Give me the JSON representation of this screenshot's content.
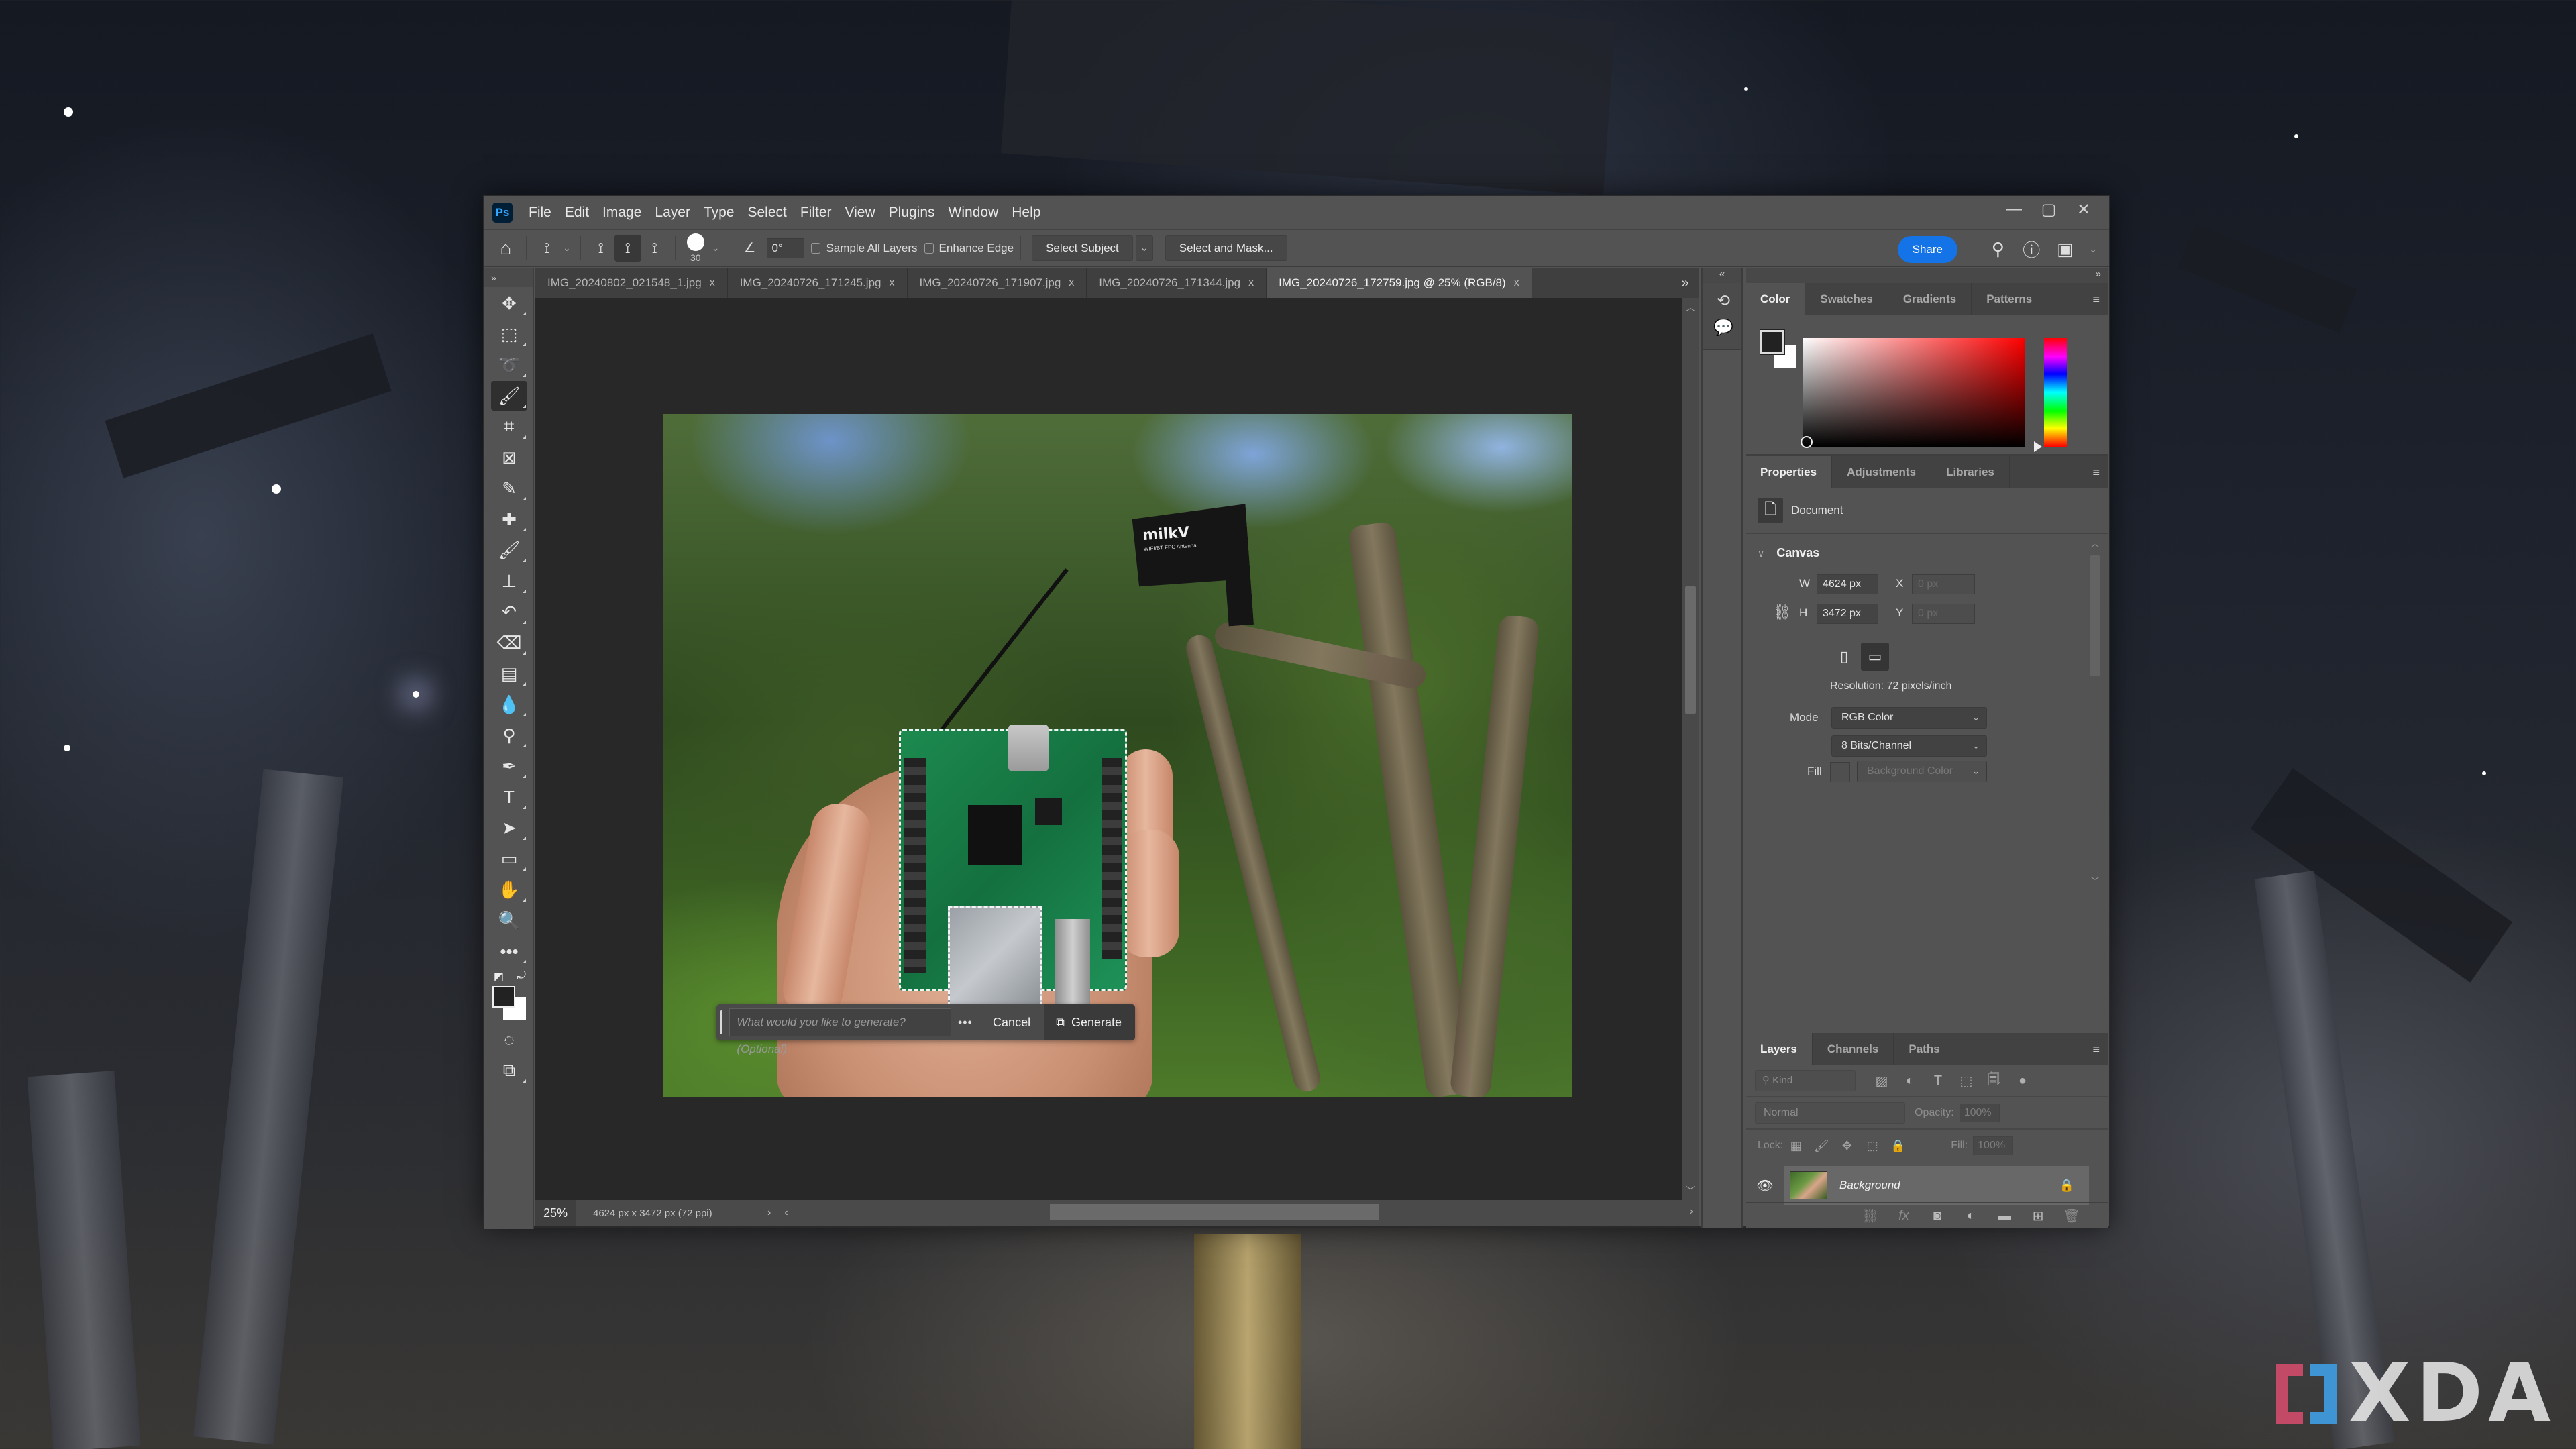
{
  "app": {
    "name": "Photoshop",
    "logo_text": "Ps",
    "menu": [
      "File",
      "Edit",
      "Image",
      "Layer",
      "Type",
      "Select",
      "Filter",
      "View",
      "Plugins",
      "Window",
      "Help"
    ],
    "window_controls": {
      "minimize": "—",
      "maximize": "▢",
      "close": "✕"
    }
  },
  "options_bar": {
    "brush_size": "30",
    "angle": "0°",
    "sample_all_layers": {
      "label": "Sample All Layers",
      "checked": false
    },
    "enhance_edge": {
      "label": "Enhance Edge",
      "checked": false
    },
    "select_subject": "Select Subject",
    "select_and_mask": "Select and Mask...",
    "share": "Share",
    "accent_color": "#1473e6"
  },
  "tabs": [
    {
      "label": "IMG_20240802_021548_1.jpg",
      "active": false
    },
    {
      "label": "IMG_20240726_171245.jpg",
      "active": false
    },
    {
      "label": "IMG_20240726_171907.jpg",
      "active": false
    },
    {
      "label": "IMG_20240726_171344.jpg",
      "active": false
    },
    {
      "label": "IMG_20240726_172759.jpg @ 25% (RGB/8)",
      "active": true
    }
  ],
  "tools": [
    {
      "name": "move-tool",
      "icon": "✥"
    },
    {
      "name": "marquee-tool",
      "icon": "⬚"
    },
    {
      "name": "lasso-tool",
      "icon": "➰"
    },
    {
      "name": "quick-selection-tool",
      "icon": "🖌",
      "active": true
    },
    {
      "name": "crop-tool",
      "icon": "⌗"
    },
    {
      "name": "frame-tool",
      "icon": "⊠"
    },
    {
      "name": "eyedropper-tool",
      "icon": "✎"
    },
    {
      "name": "healing-brush-tool",
      "icon": "✚"
    },
    {
      "name": "brush-tool",
      "icon": "🖌"
    },
    {
      "name": "clone-stamp-tool",
      "icon": "⊥"
    },
    {
      "name": "history-brush-tool",
      "icon": "↶"
    },
    {
      "name": "eraser-tool",
      "icon": "⌫"
    },
    {
      "name": "gradient-tool",
      "icon": "▤"
    },
    {
      "name": "blur-tool",
      "icon": "💧"
    },
    {
      "name": "dodge-tool",
      "icon": "⚲"
    },
    {
      "name": "pen-tool",
      "icon": "✒"
    },
    {
      "name": "type-tool",
      "icon": "T"
    },
    {
      "name": "path-selection-tool",
      "icon": "➤"
    },
    {
      "name": "rectangle-tool",
      "icon": "▭"
    },
    {
      "name": "hand-tool",
      "icon": "✋"
    },
    {
      "name": "zoom-tool",
      "icon": "🔍"
    },
    {
      "name": "more-tools",
      "icon": "•••"
    }
  ],
  "canvas": {
    "antenna_brand": "milkV",
    "antenna_sub": "WIFI/BT FPC Antenna"
  },
  "generate_bar": {
    "placeholder": "What would you like to generate? (Optional)",
    "more": "•••",
    "cancel": "Cancel",
    "generate": "Generate"
  },
  "status": {
    "zoom": "25%",
    "doc_info": "4624 px x 3472 px (72 ppi)"
  },
  "color_panel": {
    "tabs": [
      "Color",
      "Swatches",
      "Gradients",
      "Patterns"
    ],
    "active_tab": "Color",
    "foreground": "#222222",
    "background": "#ffffff",
    "hue": "#ff0000"
  },
  "properties_panel": {
    "tabs": [
      "Properties",
      "Adjustments",
      "Libraries"
    ],
    "active_tab": "Properties",
    "document_label": "Document",
    "section": "Canvas",
    "width": {
      "label": "W",
      "value": "4624 px"
    },
    "height": {
      "label": "H",
      "value": "3472 px"
    },
    "x": {
      "label": "X",
      "value": "0 px"
    },
    "y": {
      "label": "Y",
      "value": "0 px"
    },
    "resolution": "Resolution: 72 pixels/inch",
    "mode_label": "Mode",
    "mode": "RGB Color",
    "bit_depth": "8 Bits/Channel",
    "fill_label": "Fill",
    "fill": "Background Color"
  },
  "layers_panel": {
    "tabs": [
      "Layers",
      "Channels",
      "Paths"
    ],
    "active_tab": "Layers",
    "filter_kind": "Kind",
    "blend_mode": "Normal",
    "opacity_label": "Opacity:",
    "opacity": "100%",
    "lock_label": "Lock:",
    "fill_label": "Fill:",
    "fill": "100%",
    "layers": [
      {
        "name": "Background",
        "visible": true,
        "locked": true
      }
    ]
  },
  "watermark": "XDA"
}
